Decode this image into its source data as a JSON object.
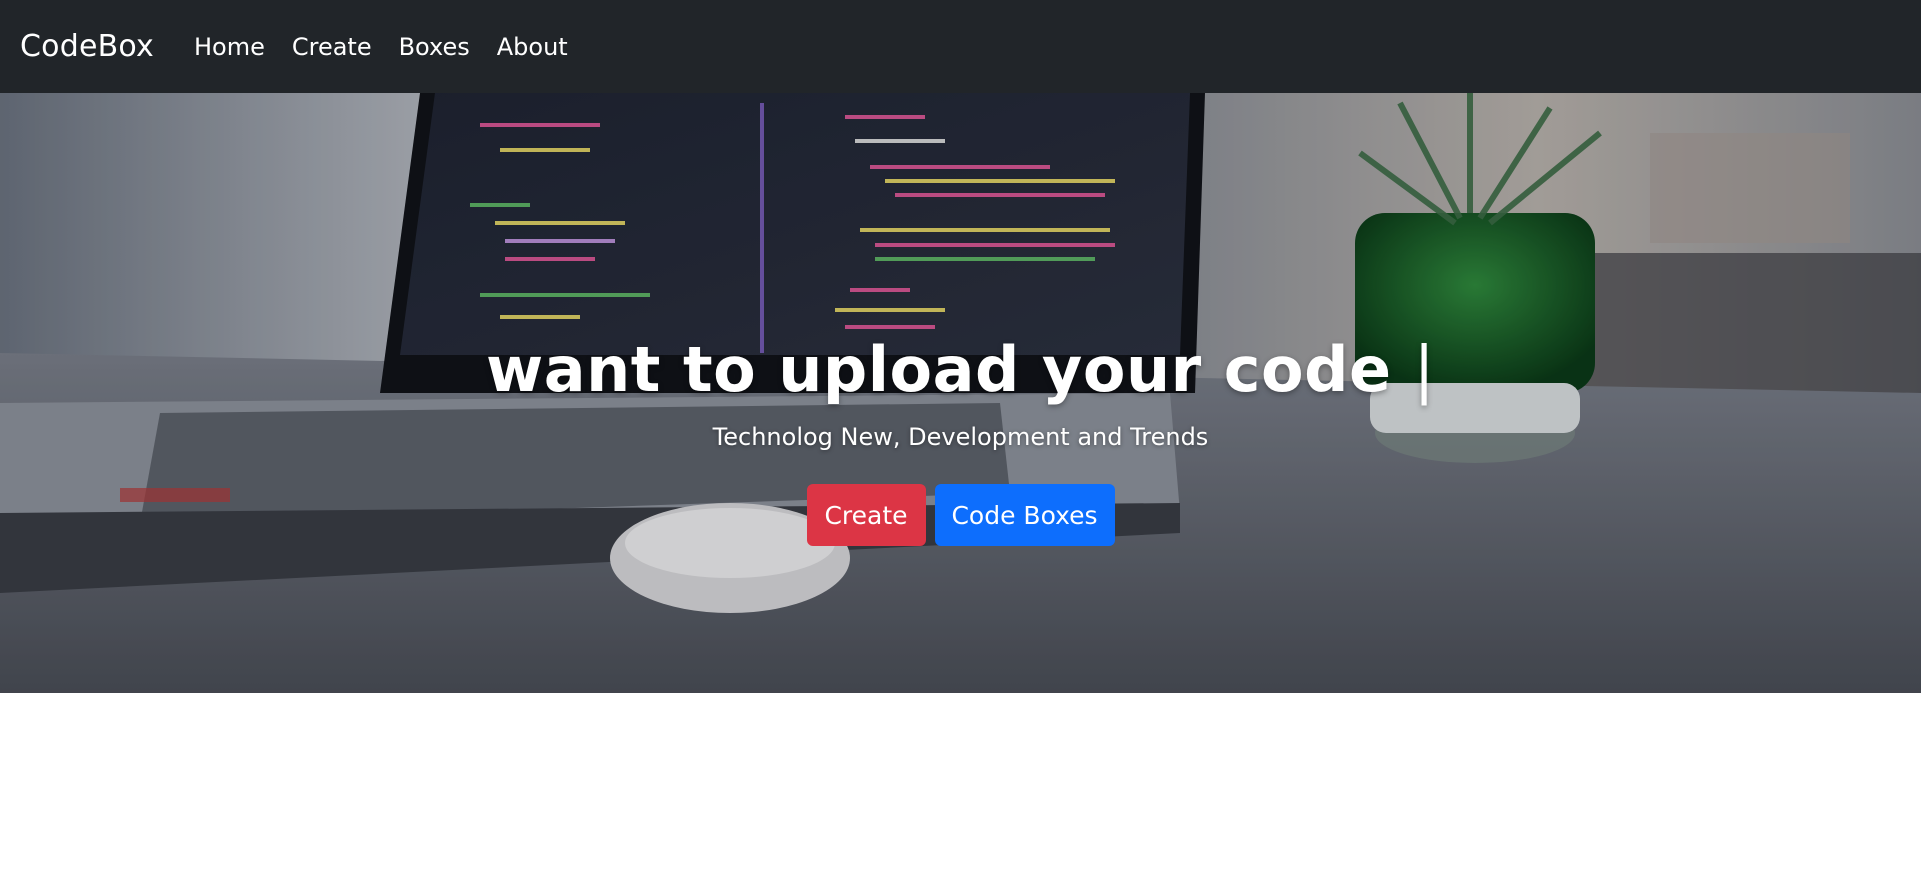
{
  "navbar": {
    "brand": "CodeBox",
    "items": [
      {
        "label": "Home"
      },
      {
        "label": "Create"
      },
      {
        "label": "Boxes"
      },
      {
        "label": "About"
      }
    ]
  },
  "hero": {
    "headline": "want to upload your code",
    "cursor": "|",
    "subheading": "Technolog New, Development and Trends",
    "buttons": {
      "create": "Create",
      "code_boxes": "Code Boxes"
    }
  },
  "colors": {
    "navbar_bg": "#212529",
    "create_button": "#dc3545",
    "code_boxes_button": "#0d6efd"
  }
}
